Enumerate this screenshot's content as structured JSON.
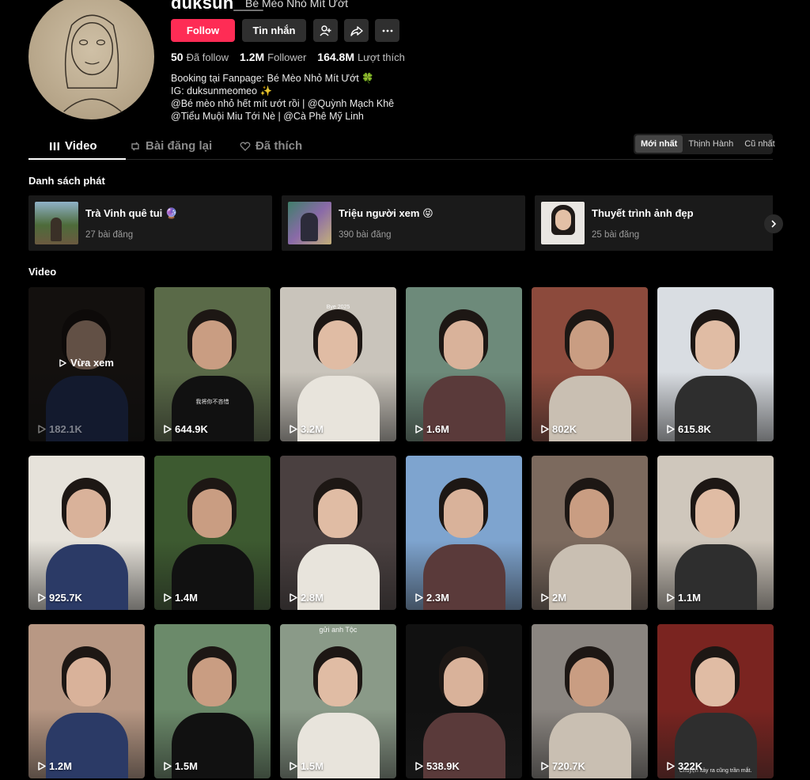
{
  "profile": {
    "username": "duksun___",
    "nickname": "Bé Mèo Nhỏ Mít Ướt",
    "follow_label": "Follow",
    "message_label": "Tin nhắn",
    "stats": [
      {
        "value": "50",
        "label": "Đã follow"
      },
      {
        "value": "1.2M",
        "label": "Follower"
      },
      {
        "value": "164.8M",
        "label": "Lượt thích"
      }
    ],
    "bio": [
      "Booking tại Fanpage: Bé Mèo Nhỏ Mít Ướt 🍀",
      "IG: duksunmeomeo ✨",
      "@Bé mèo nhỏ hết mít ướt rồi | @Quỳnh Mạch Khê",
      "@Tiểu Muội Miu Tới Nè | @Cà Phê Mỹ Linh"
    ]
  },
  "tabs": [
    {
      "label": "Video",
      "icon": "grid-icon",
      "active": true
    },
    {
      "label": "Bài đăng lại",
      "icon": "repost-icon",
      "active": false
    },
    {
      "label": "Đã thích",
      "icon": "heart-icon",
      "active": false
    }
  ],
  "sort": [
    "Mới nhất",
    "Thịnh Hành",
    "Cũ nhất"
  ],
  "playlists_title": "Danh sách phát",
  "playlists": [
    {
      "title": "Trà Vinh quê tui 🔮",
      "count": "27 bài đăng"
    },
    {
      "title": "Triệu người xem 😝",
      "count": "390 bài đăng"
    },
    {
      "title": "Thuyết trình ảnh đẹp",
      "count": "25 bài đăng"
    }
  ],
  "videos_title": "Video",
  "just_watched_label": "Vừa xem",
  "videos": [
    {
      "views": "182.1K",
      "bg": "#2a2420",
      "caption": ""
    },
    {
      "views": "644.9K",
      "bg": "#5a6a48",
      "caption": "我将你不吝惜"
    },
    {
      "views": "3.2M",
      "bg": "#c9c4bb",
      "caption": "Bye 2025"
    },
    {
      "views": "1.6M",
      "bg": "#6d8a7a",
      "caption": ""
    },
    {
      "views": "802K",
      "bg": "#8c4a3c",
      "caption": ""
    },
    {
      "views": "615.8K",
      "bg": "#d9dde2",
      "caption": ""
    },
    {
      "views": "925.7K",
      "bg": "#e6e2da",
      "caption": ""
    },
    {
      "views": "1.4M",
      "bg": "#3d5a30",
      "caption": ""
    },
    {
      "views": "2.8M",
      "bg": "#4a4040",
      "caption": ""
    },
    {
      "views": "2.3M",
      "bg": "#7ea4cf",
      "caption": ""
    },
    {
      "views": "2M",
      "bg": "#7c6a5e",
      "caption": ""
    },
    {
      "views": "1.1M",
      "bg": "#cfc7bc",
      "caption": ""
    },
    {
      "views": "1.2M",
      "bg": "#b89884",
      "caption": ""
    },
    {
      "views": "1.5M",
      "bg": "#6b8a6a",
      "caption": ""
    },
    {
      "views": "1.5M",
      "bg": "#8a9a88",
      "caption": "gửi anh Tộc"
    },
    {
      "views": "538.9K",
      "bg": "#111111",
      "caption": ""
    },
    {
      "views": "720.7K",
      "bg": "#8a8580",
      "caption": ""
    },
    {
      "views": "322K",
      "bg": "#7a2420",
      "caption": "Chuyện xảy ra cũng trần mắt."
    }
  ],
  "colors": {
    "accent": "#fe2c55",
    "background": "#000000",
    "card": "#1a1a1a"
  }
}
